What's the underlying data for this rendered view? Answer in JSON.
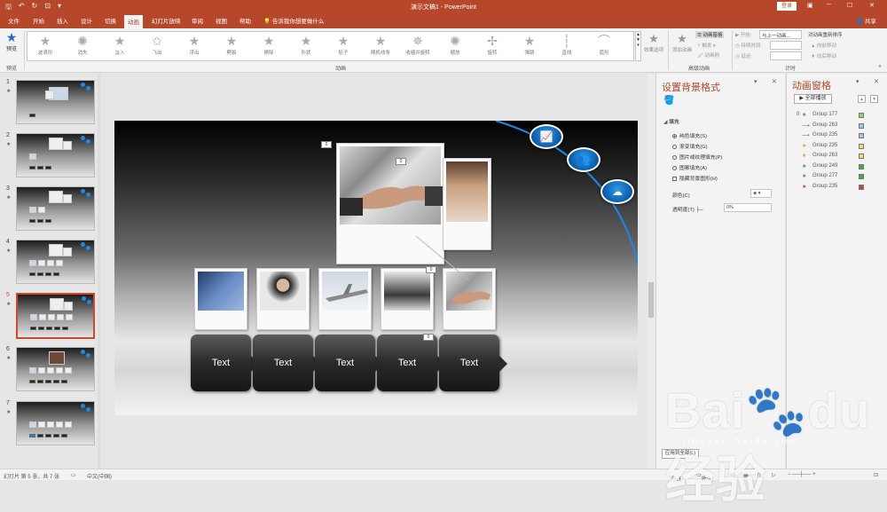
{
  "titlebar": {
    "title": "演示文稿1 - PowerPoint",
    "login": "登录"
  },
  "tabs": [
    "文件",
    "开始",
    "插入",
    "设计",
    "切换",
    "动画",
    "幻灯片放映",
    "审阅",
    "视图",
    "帮助"
  ],
  "tell_me": "告诉我你想要做什么",
  "share": "共享",
  "ribbon": {
    "preview": "预览",
    "preview_group": "预览",
    "animations": [
      "波浪形",
      "消失",
      "淡入",
      "飞出",
      "浮出",
      "劈裂",
      "擦除",
      "形状",
      "轮子",
      "随机线条",
      "收缩并旋转",
      "缩放",
      "旋转",
      "弹跳",
      "直线",
      "弧形"
    ],
    "effect_options": "效果选项",
    "add_animation": "添加动画",
    "anim_pane": "动画窗格",
    "trigger": "触发",
    "anim_painter": "动画刷",
    "advanced_group": "高级动画",
    "start_label": "开始:",
    "start_value": "与上一动画...",
    "duration_label": "持续时间:",
    "delay_label": "延迟:",
    "reorder": "对动画重新排序",
    "move_earlier": "向前移动",
    "move_later": "向后移动",
    "timing_group": "计时",
    "animation_group": "动画"
  },
  "slides": [
    {
      "num": "1",
      "star": "★"
    },
    {
      "num": "2",
      "star": "★"
    },
    {
      "num": "3",
      "star": "★"
    },
    {
      "num": "4",
      "star": "★"
    },
    {
      "num": "5",
      "star": "★"
    },
    {
      "num": "6",
      "star": "★"
    },
    {
      "num": "7",
      "star": "★"
    }
  ],
  "slide": {
    "buttons": [
      "Text",
      "Text",
      "Text",
      "Text",
      "Text"
    ],
    "tags": [
      "0",
      "0",
      "0",
      "0"
    ]
  },
  "format_pane": {
    "title": "设置背景格式",
    "fill_section": "填充",
    "options": [
      "纯色填充(S)",
      "渐变填充(G)",
      "图片或纹理填充(P)",
      "图案填充(A)",
      "隐藏背景图形(H)"
    ],
    "color_label": "颜色(C)",
    "transparency_label": "透明度(T)",
    "transparency_value": "0%",
    "apply_all": "应用到全部(L)"
  },
  "anim_pane": {
    "title": "动画窗格",
    "play_all": "全部播放",
    "first_index": "0",
    "items": [
      {
        "name": "Group 177",
        "icon": "★",
        "color": "#3a9a6a",
        "bar": "#8bd36b"
      },
      {
        "name": "Group 263",
        "icon": "⟶",
        "color": "#666",
        "bar": "#9cc6e4"
      },
      {
        "name": "Group 235",
        "icon": "⟶",
        "color": "#666",
        "bar": "#9cc6e4"
      },
      {
        "name": "Group 235",
        "icon": "★",
        "color": "#e0a030",
        "bar": "#f7d86a"
      },
      {
        "name": "Group 263",
        "icon": "★",
        "color": "#e0a030",
        "bar": "#f7d86a"
      },
      {
        "name": "Group 249",
        "icon": "★",
        "color": "#3a9a6a",
        "bar": "#3fb03f"
      },
      {
        "name": "Group 277",
        "icon": "★",
        "color": "#3a9a6a",
        "bar": "#3fb03f"
      },
      {
        "name": "Group 235",
        "icon": "★",
        "color": "#c04040",
        "bar": "#d04040"
      }
    ]
  },
  "status": {
    "slide_info": "幻灯片 第 5 张，共 7 张",
    "lang": "中文(中国)",
    "notes": "备注",
    "comments": "批注"
  },
  "watermark": {
    "text": "Baidu经验",
    "url": "jingyan.baidu.com"
  }
}
